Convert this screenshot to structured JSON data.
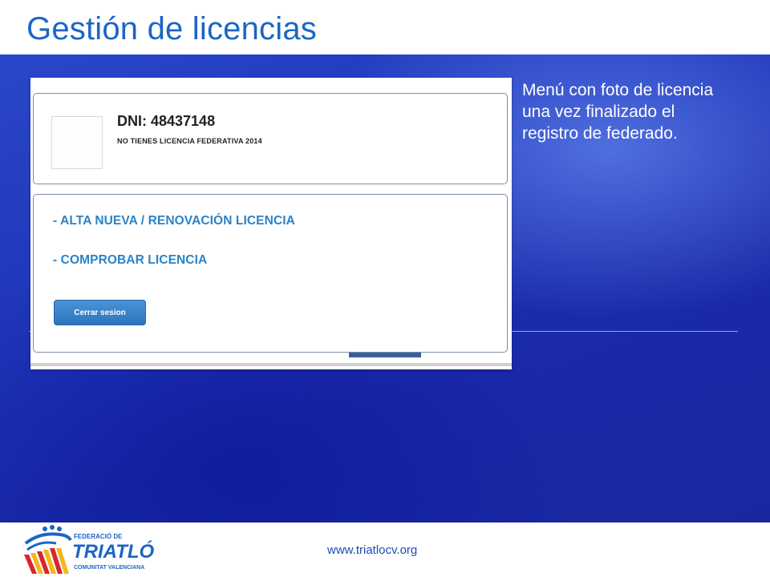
{
  "slide": {
    "title": "Gestión de licencias",
    "caption": "Menú con foto de licencia una vez finalizado el registro de federado.",
    "footer_url": "www.triatlocv.org"
  },
  "app": {
    "dni": "DNI: 48437148",
    "licence_status": "NO TIENES LICENCIA FEDERATIVA 2014",
    "menu": [
      {
        "label": "- ALTA NUEVA / RENOVACIÓN LICENCIA"
      },
      {
        "label": "- COMPROBAR LICENCIA"
      }
    ],
    "logout_label": "Cerrar sesion"
  },
  "logo": {
    "line1": "FEDERACIÓ DE",
    "line2": "TRIATLÓ",
    "line3": "COMUNITAT VALENCIANA"
  },
  "colors": {
    "title": "#1a66c4",
    "background": "#1f36bb",
    "link": "#2a83c6",
    "button": "#2d74bd",
    "logo_red": "#d8262c",
    "logo_yellow": "#f2b91d"
  }
}
